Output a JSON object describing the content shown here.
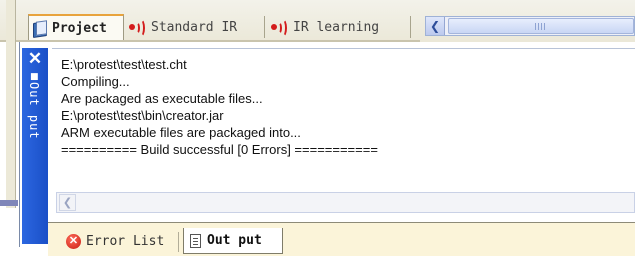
{
  "top_tabs": [
    {
      "label": "Project",
      "icon": "book-icon",
      "active": true
    },
    {
      "label": "Standard IR",
      "icon": "ir-signal-icon",
      "active": false
    },
    {
      "label": "IR learning",
      "icon": "ir-signal-icon",
      "active": false
    }
  ],
  "output_panel": {
    "title": "Out put",
    "close_symbol": "✕",
    "lines": [
      "E:\\protest\\test\\test.cht",
      "Compiling...",
      "Are packaged as executable files...",
      "E:\\protest\\test\\bin\\creator.jar",
      "ARM executable files are packaged into...",
      "========== Build successful [0 Errors] ==========="
    ]
  },
  "bottom_tabs": [
    {
      "label": "Error List",
      "icon": "error-icon",
      "active": false
    },
    {
      "label": "Out put",
      "icon": "document-icon",
      "active": true
    }
  ],
  "colors": {
    "panel_title_blue": "#1a4fc7",
    "active_tab_accent": "#e8a33c",
    "ir_icon_red": "#d31c1c",
    "bottom_strip": "#fbf4d9"
  }
}
